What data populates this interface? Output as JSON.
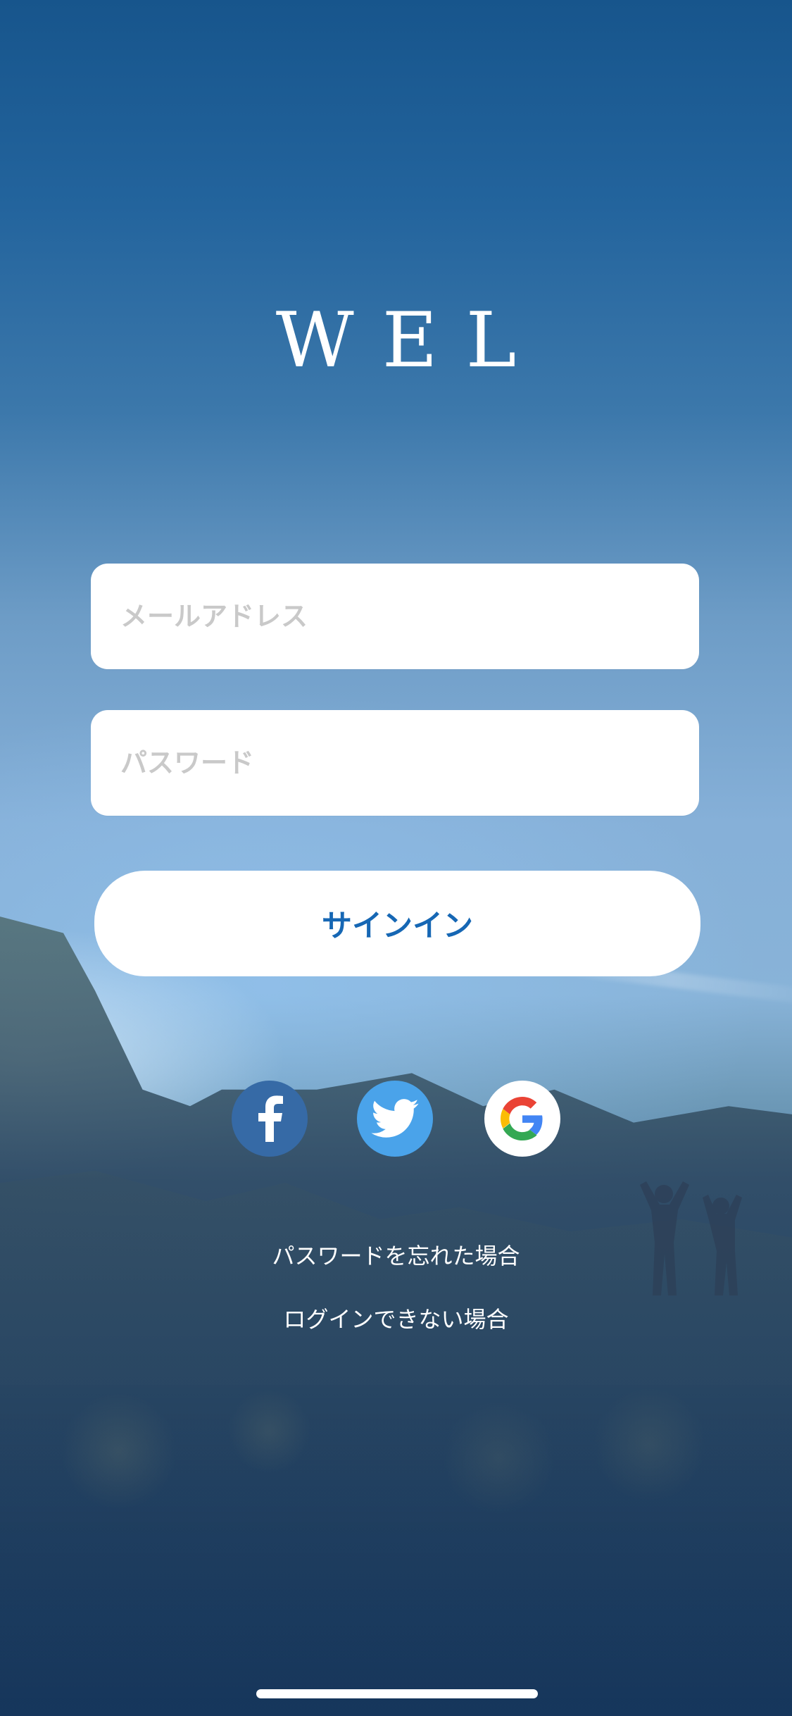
{
  "brand": {
    "logo_text": "WEL"
  },
  "login_form": {
    "email_placeholder": "メールアドレス",
    "password_placeholder": "パスワード",
    "signin_label": "サインイン"
  },
  "social_login": {
    "items": [
      {
        "name": "facebook",
        "icon": "facebook-icon",
        "color": "#366aa6"
      },
      {
        "name": "twitter",
        "icon": "twitter-icon",
        "color": "#4aa3ea"
      },
      {
        "name": "google",
        "icon": "google-icon",
        "color": "#ffffff"
      }
    ]
  },
  "links": {
    "forgot_password": "パスワードを忘れた場合",
    "cannot_login": "ログインできない場合"
  }
}
